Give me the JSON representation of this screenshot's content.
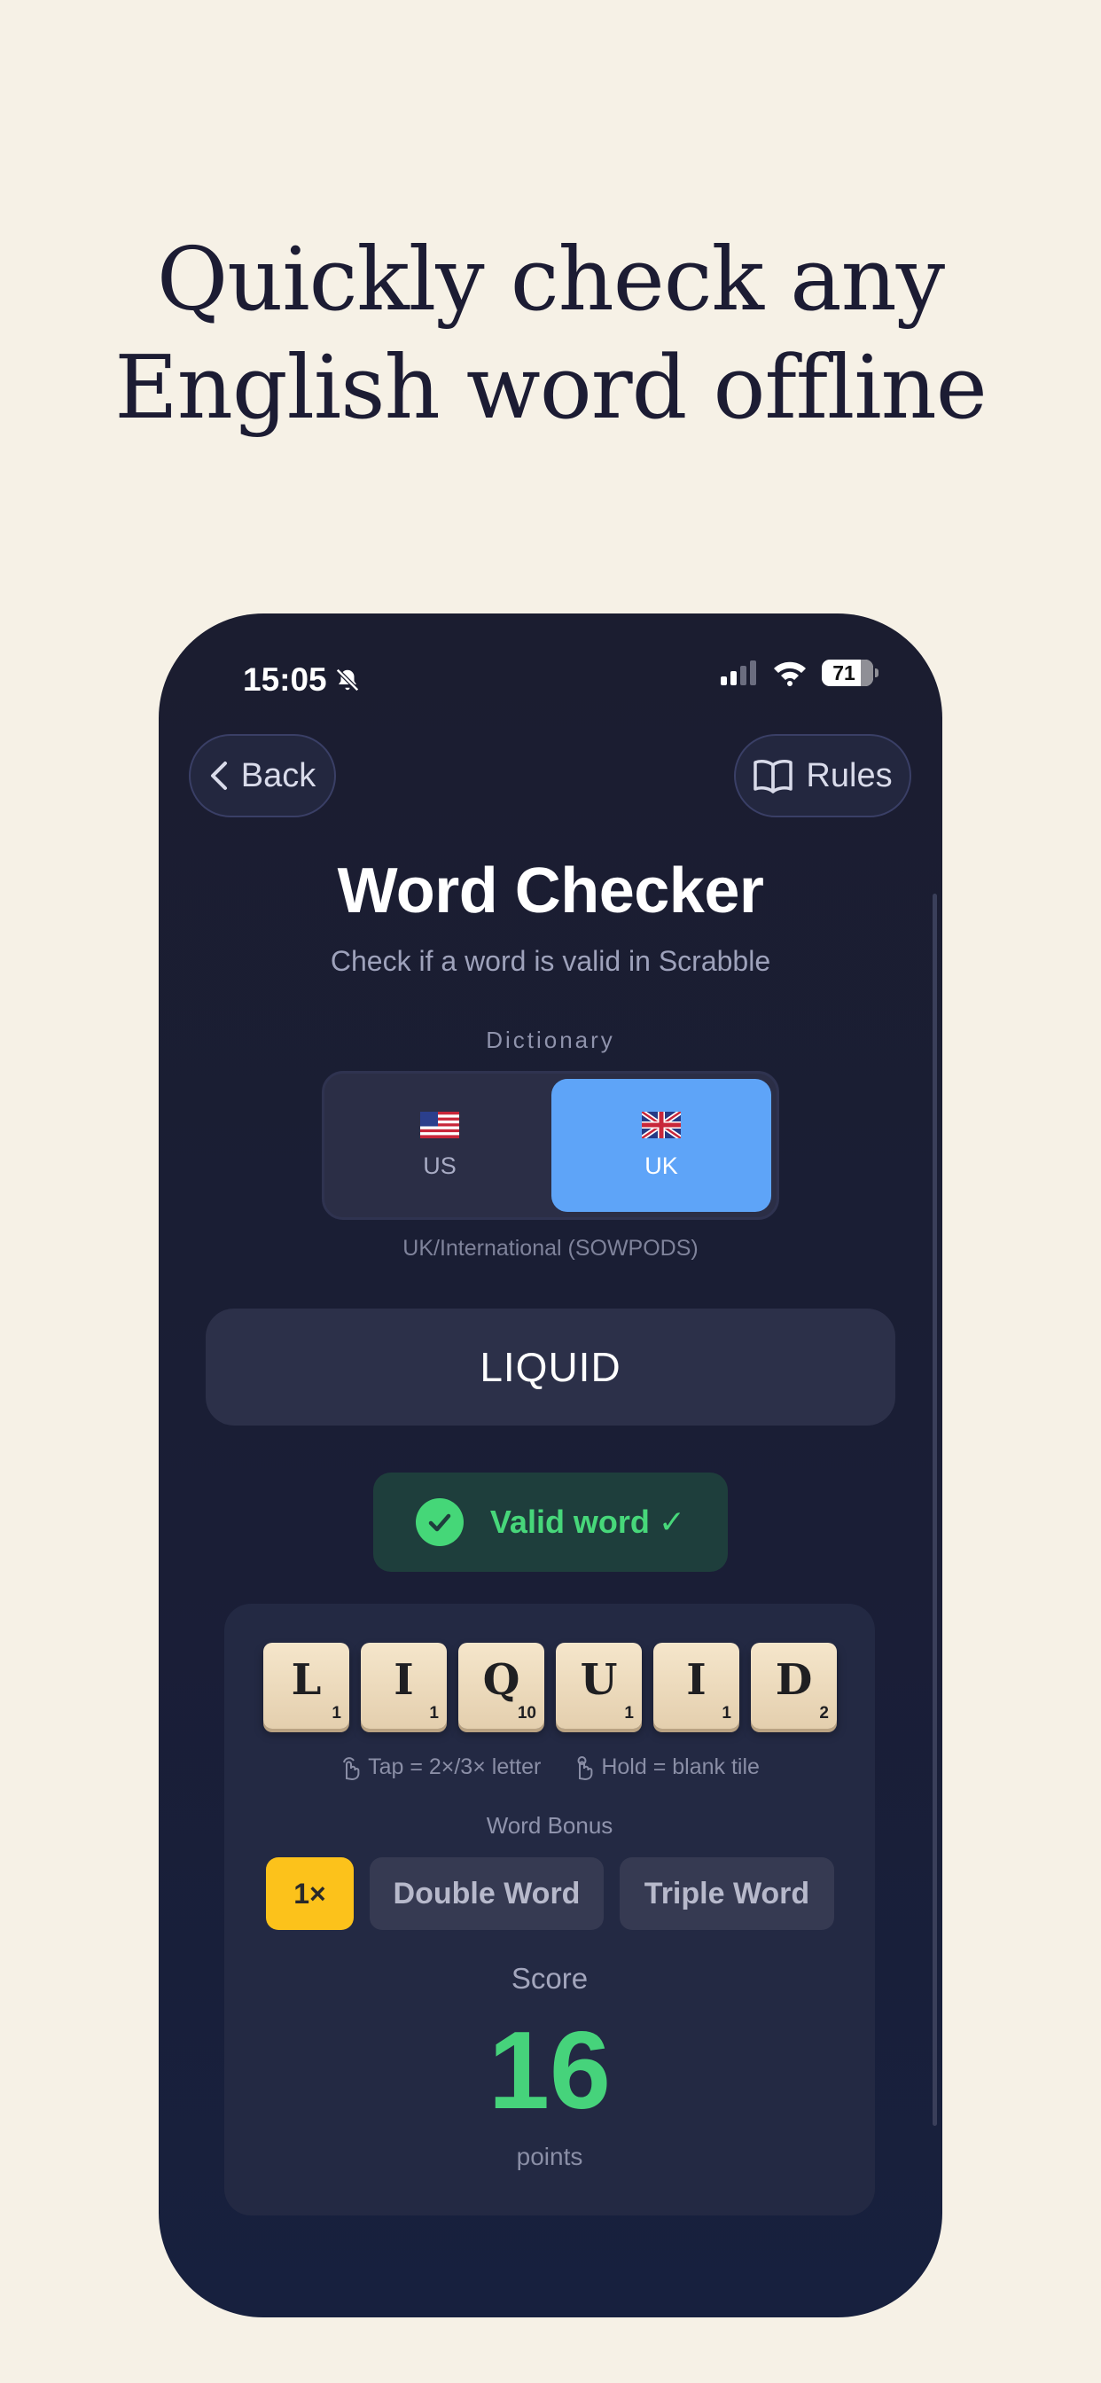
{
  "headline": {
    "line1": "Quickly check any",
    "line2": "English word offline"
  },
  "status_bar": {
    "time": "15:05",
    "battery": "71",
    "icons": [
      "mute-bell-icon",
      "signal-icon",
      "wifi-icon",
      "battery-icon"
    ]
  },
  "nav": {
    "back_label": "Back",
    "rules_label": "Rules"
  },
  "page": {
    "title": "Word Checker",
    "subtitle": "Check if a word is valid in Scrabble"
  },
  "dictionary": {
    "label": "Dictionary",
    "options": [
      {
        "label": "US",
        "flag": "us-flag-icon"
      },
      {
        "label": "UK",
        "flag": "uk-flag-icon",
        "selected": true
      }
    ],
    "description": "UK/International (SOWPODS)"
  },
  "word_input": {
    "value": "LIQUID"
  },
  "result": {
    "text": "Valid word ✓",
    "color": "#47d77a"
  },
  "tiles": [
    {
      "letter": "L",
      "points": "1"
    },
    {
      "letter": "I",
      "points": "1"
    },
    {
      "letter": "Q",
      "points": "10"
    },
    {
      "letter": "U",
      "points": "1"
    },
    {
      "letter": "I",
      "points": "1"
    },
    {
      "letter": "D",
      "points": "2"
    }
  ],
  "hints": {
    "tap": "Tap = 2×/3× letter",
    "hold": "Hold = blank tile"
  },
  "bonus": {
    "label": "Word Bonus",
    "options": [
      {
        "label": "1×",
        "selected": true
      },
      {
        "label": "Double Word"
      },
      {
        "label": "Triple Word"
      }
    ],
    "accent": "#fcc21b"
  },
  "score": {
    "label": "Score",
    "value": "16",
    "unit": "points",
    "color": "#46d37b"
  },
  "colors": {
    "background": "#f6f1e6",
    "phone": "#1b1d30",
    "selected_dictionary": "#5ea4f8"
  }
}
